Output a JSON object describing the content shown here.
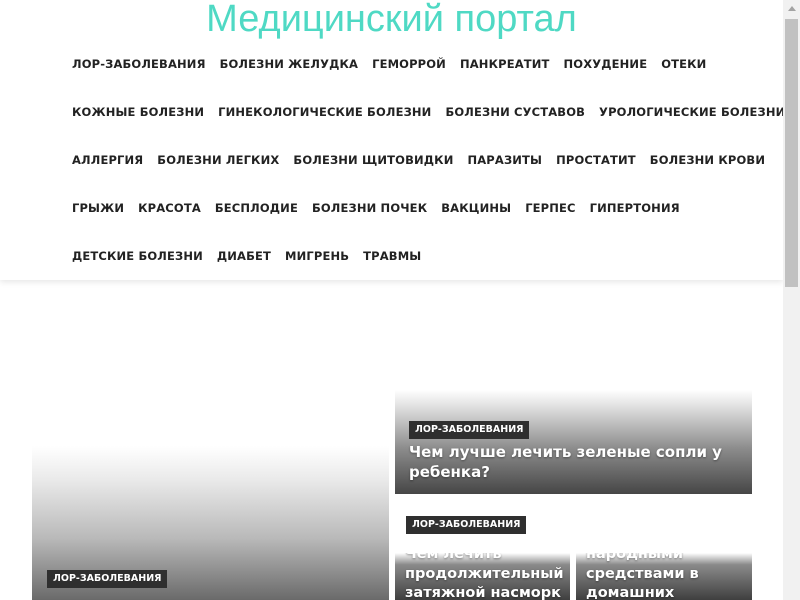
{
  "site": {
    "title": "Медицинский портал"
  },
  "nav": {
    "rows": [
      [
        "ЛОР-ЗАБОЛЕВАНИЯ",
        "БОЛЕЗНИ ЖЕЛУДКА",
        "ГЕМОРРОЙ",
        "ПАНКРЕАТИТ",
        "ПОХУДЕНИЕ",
        "ОТЕКИ"
      ],
      [
        "КОЖНЫЕ БОЛЕЗНИ",
        "ГИНЕКОЛОГИЧЕСКИЕ БОЛЕЗНИ",
        "БОЛЕЗНИ СУСТАВОВ",
        "УРОЛОГИЧЕСКИЕ БОЛЕЗНИ"
      ],
      [
        "АЛЛЕРГИЯ",
        "БОЛЕЗНИ ЛЕГКИХ",
        "БОЛЕЗНИ ЩИТОВИДКИ",
        "ПАРАЗИТЫ",
        "ПРОСТАТИТ",
        "БОЛЕЗНИ КРОВИ"
      ],
      [
        "ГРЫЖИ",
        "КРАСОТА",
        "БЕСПЛОДИЕ",
        "БОЛЕЗНИ ПОЧЕК",
        "ВАКЦИНЫ",
        "ГЕРПЕС",
        "ГИПЕРТОНИЯ"
      ],
      [
        "ДЕТСКИЕ БОЛЕЗНИ",
        "ДИАБЕТ",
        "МИГРЕНЬ",
        "ТРАВМЫ"
      ]
    ]
  },
  "cards": {
    "big": {
      "category": "ЛОР-ЗАБОЛЕВАНИЯ"
    },
    "top_right": {
      "category": "ЛОР-ЗАБОЛЕВАНИЯ",
      "title": "Чем лучше лечить зеленые сопли у ребенка?"
    },
    "small_left": {
      "category": "ЛОР-ЗАБОЛЕВАНИЯ",
      "title": "Чем лечить продолжительный затяжной насморк"
    },
    "small_right": {
      "title": "народными средствами в домашних"
    }
  },
  "colors": {
    "title": "#4fd9c4",
    "nav_text": "#222222",
    "badge_bg": "#2f2f2f",
    "badge_text": "#ffffff"
  }
}
